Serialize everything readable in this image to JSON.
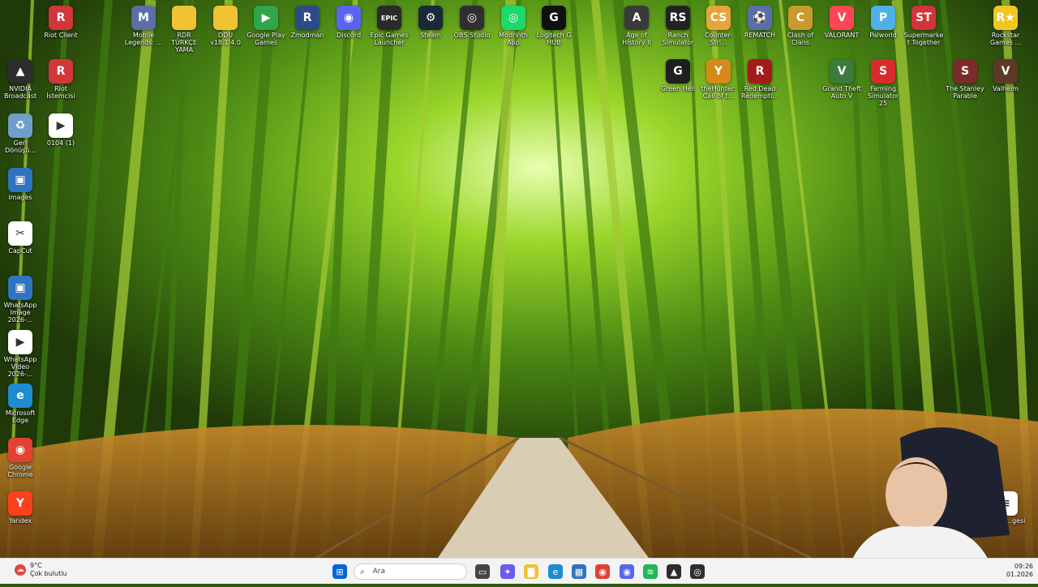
{
  "desktop_icons": [
    {
      "label": "Riot Client",
      "icon": "riot-icon",
      "color": "#d13639",
      "glyph": "R"
    },
    {
      "label": "Mobile Legends: ...",
      "icon": "game-icon",
      "color": "#5a6fa8",
      "glyph": "M"
    },
    {
      "label": "RDR TÜRKÇE YAMA",
      "icon": "folder-icon",
      "color": "#f1c232",
      "glyph": ""
    },
    {
      "label": "DDU v18.1.4.0",
      "icon": "folder-icon",
      "color": "#f1c232",
      "glyph": ""
    },
    {
      "label": "Google Play Games",
      "icon": "play-games-icon",
      "color": "#2fa64a",
      "glyph": "▶"
    },
    {
      "label": "Zmodman",
      "icon": "r-icon",
      "color": "#2c4a86",
      "glyph": "R"
    },
    {
      "label": "Discord",
      "icon": "discord-icon",
      "color": "#5865f2",
      "glyph": "◉"
    },
    {
      "label": "Epic Games Launcher",
      "icon": "epic-icon",
      "color": "#2a2a2a",
      "glyph": "EPIC"
    },
    {
      "label": "Steam",
      "icon": "steam-icon",
      "color": "#1b2838",
      "glyph": "⚙"
    },
    {
      "label": "OBS Studio",
      "icon": "obs-icon",
      "color": "#302e31",
      "glyph": "◎"
    },
    {
      "label": "Modrinth App",
      "icon": "modrinth-icon",
      "color": "#1bd96a",
      "glyph": "◎"
    },
    {
      "label": "Logitech G HUB",
      "icon": "logitech-icon",
      "color": "#111111",
      "glyph": "G"
    },
    {
      "label": "Age of History II",
      "icon": "game-icon",
      "color": "#3a3a3a",
      "glyph": "A"
    },
    {
      "label": "Ranch Simulator",
      "icon": "game-icon",
      "color": "#222222",
      "glyph": "RS"
    },
    {
      "label": "Counter-Stri...",
      "icon": "cs-icon",
      "color": "#e8a33c",
      "glyph": "CS"
    },
    {
      "label": "REMATCH",
      "icon": "game-icon",
      "color": "#5a6fa8",
      "glyph": "⚽"
    },
    {
      "label": "Clash of Clans",
      "icon": "game-icon",
      "color": "#c99a2e",
      "glyph": "C"
    },
    {
      "label": "VALORANT",
      "icon": "valorant-icon",
      "color": "#fd4556",
      "glyph": "V"
    },
    {
      "label": "Palworld",
      "icon": "game-icon",
      "color": "#4fb0e8",
      "glyph": "P"
    },
    {
      "label": "Supermarket Together",
      "icon": "game-icon",
      "color": "#d3333a",
      "glyph": "ST"
    },
    {
      "label": "Rockstar Games ...",
      "icon": "rockstar-icon",
      "color": "#f3c61f",
      "glyph": "R★"
    },
    {
      "label": "NVIDIA Broadcast",
      "icon": "nvidia-icon",
      "color": "#2d2d2d",
      "glyph": "▲"
    },
    {
      "label": "Riot İstemcisi",
      "icon": "riot-icon",
      "color": "#d13639",
      "glyph": "R"
    },
    {
      "label": "Green Hell",
      "icon": "game-icon",
      "color": "#1f1f1f",
      "glyph": "G"
    },
    {
      "label": "theHunter: Call of t...",
      "icon": "game-icon",
      "color": "#d58a1a",
      "glyph": "Y"
    },
    {
      "label": "Red Dead Redempti...",
      "icon": "game-icon",
      "color": "#a51b1b",
      "glyph": "R"
    },
    {
      "label": "Grand Theft Auto V",
      "icon": "gta-icon",
      "color": "#3d7a3d",
      "glyph": "V"
    },
    {
      "label": "Farming Simulator 25",
      "icon": "game-icon",
      "color": "#d72b2b",
      "glyph": "S"
    },
    {
      "label": "The Stanley Parable",
      "icon": "game-icon",
      "color": "#7a2c2c",
      "glyph": "S"
    },
    {
      "label": "Valheim",
      "icon": "game-icon",
      "color": "#5c3a25",
      "glyph": "V"
    },
    {
      "label": "Geri Dönüşü...",
      "icon": "recycle-bin-icon",
      "color": "#6f9fc8",
      "glyph": "♻"
    },
    {
      "label": "0104 (1)",
      "icon": "video-file-icon",
      "color": "#ffffff",
      "glyph": "▶"
    },
    {
      "label": "images",
      "icon": "image-file-icon",
      "color": "#2f74c0",
      "glyph": "▣"
    },
    {
      "label": "CapCut",
      "icon": "capcut-icon",
      "color": "#ffffff",
      "glyph": "✂"
    },
    {
      "label": "WhatsApp Image 2026-...",
      "icon": "image-file-icon",
      "color": "#2f74c0",
      "glyph": "▣"
    },
    {
      "label": "WhatsApp Video 2026-...",
      "icon": "video-file-icon",
      "color": "#ffffff",
      "glyph": "▶"
    },
    {
      "label": "Microsoft Edge",
      "icon": "edge-icon",
      "color": "#1f8bd1",
      "glyph": "e"
    },
    {
      "label": "Google Chrome",
      "icon": "chrome-icon",
      "color": "#e34133",
      "glyph": "◉"
    },
    {
      "label": "Yandex",
      "icon": "yandex-icon",
      "color": "#fc3f1d",
      "glyph": "Y"
    },
    {
      "label": "Metin ...gesi",
      "icon": "text-file-icon",
      "color": "#ffffff",
      "glyph": "≡"
    }
  ],
  "taskbar": {
    "weather_temp": "9°C",
    "weather_desc": "Çok bulutlu",
    "search_placeholder": "Ara",
    "time": "09:26",
    "date": "01.2026",
    "apps": [
      {
        "name": "task-view",
        "color": "#444444",
        "glyph": "▭"
      },
      {
        "name": "copilot",
        "color": "#6a5cf0",
        "glyph": "✦"
      },
      {
        "name": "file-explorer",
        "color": "#f1c232",
        "glyph": "▇"
      },
      {
        "name": "edge",
        "color": "#1f8bd1",
        "glyph": "e"
      },
      {
        "name": "store",
        "color": "#2f74c0",
        "glyph": "▦"
      },
      {
        "name": "chrome",
        "color": "#e34133",
        "glyph": "◉"
      },
      {
        "name": "discord",
        "color": "#5865f2",
        "glyph": "◉"
      },
      {
        "name": "spotify",
        "color": "#1db954",
        "glyph": "≋"
      },
      {
        "name": "nvidia",
        "color": "#2d2d2d",
        "glyph": "▲"
      },
      {
        "name": "obs",
        "color": "#302e31",
        "glyph": "◎"
      }
    ]
  },
  "colors": {
    "accent": "#0a64d8",
    "taskbar": "#f3f3f3"
  }
}
